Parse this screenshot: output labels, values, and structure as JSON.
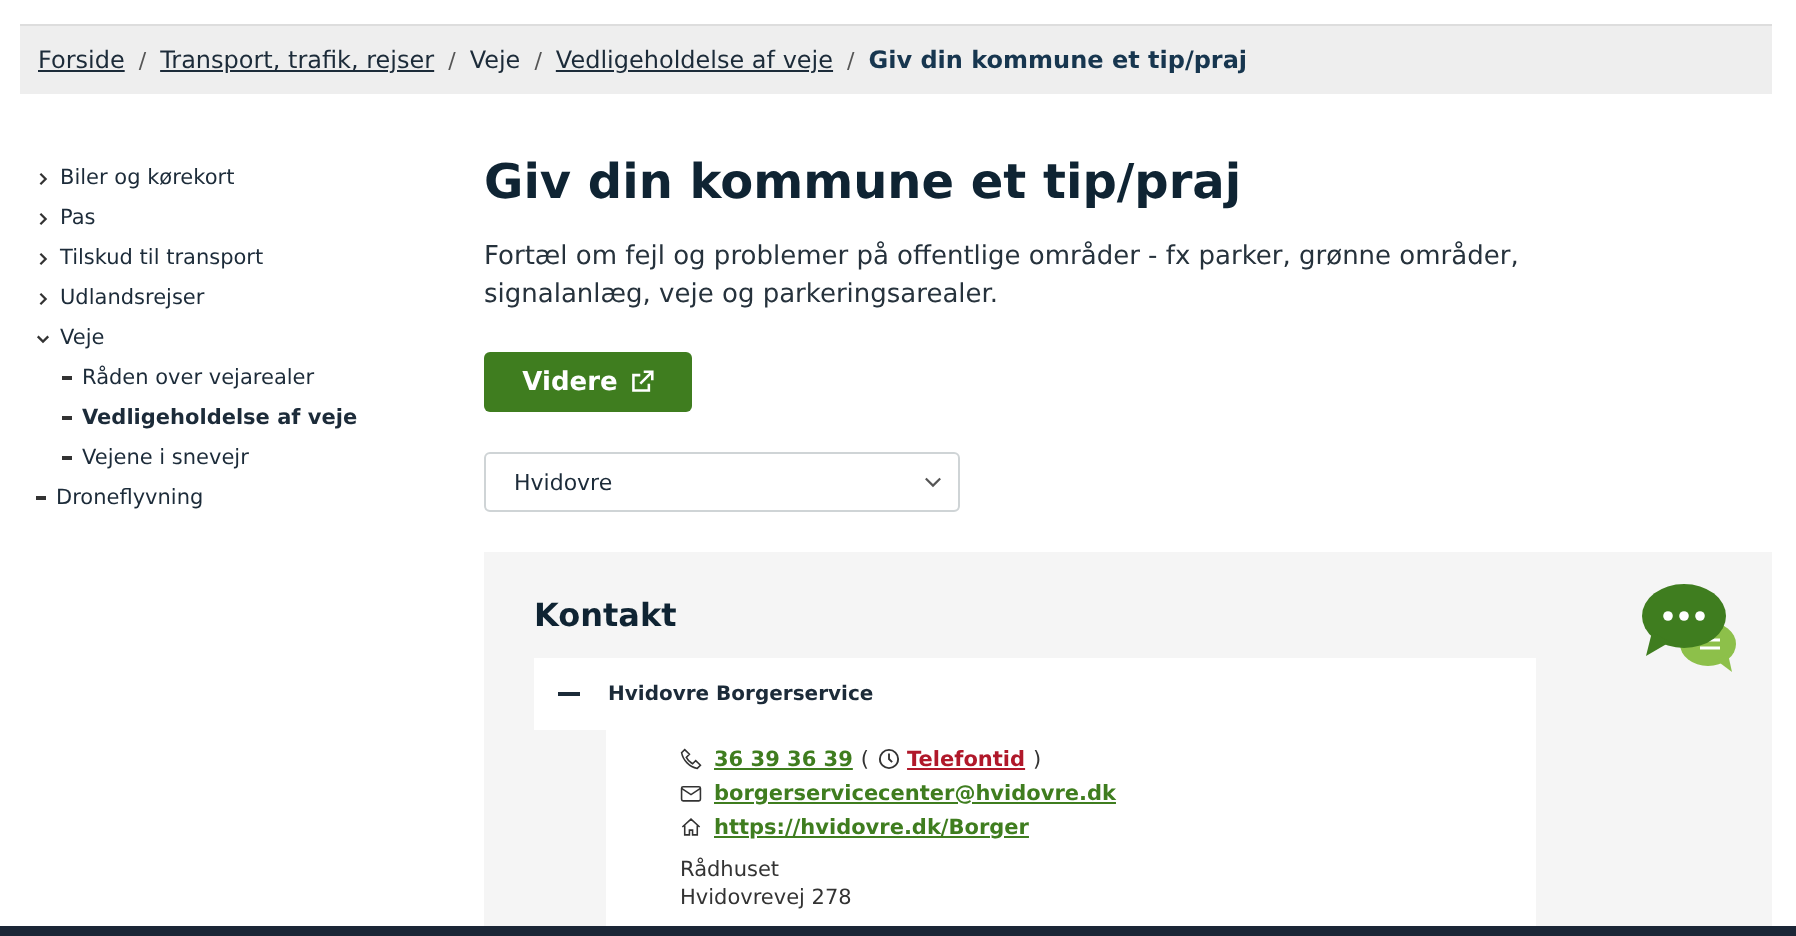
{
  "breadcrumb": {
    "separator": "/",
    "items": [
      {
        "label": "Forside",
        "link": true
      },
      {
        "label": "Transport, trafik, rejser",
        "link": true
      },
      {
        "label": "Veje",
        "link": false
      },
      {
        "label": "Vedligeholdelse af veje",
        "link": true
      },
      {
        "label": "Giv din kommune et tip/praj",
        "link": false
      }
    ]
  },
  "sidebar": {
    "items": [
      {
        "label": "Biler og kørekort",
        "kind": "section",
        "expanded": false
      },
      {
        "label": "Pas",
        "kind": "section",
        "expanded": false
      },
      {
        "label": "Tilskud til transport",
        "kind": "section",
        "expanded": false
      },
      {
        "label": "Udlandsrejser",
        "kind": "section",
        "expanded": false
      },
      {
        "label": "Veje",
        "kind": "section",
        "expanded": true,
        "children": [
          {
            "label": "Råden over vejarealer",
            "selected": false
          },
          {
            "label": "Vedligeholdelse af veje",
            "selected": true
          },
          {
            "label": "Vejene i snevejr",
            "selected": false
          }
        ]
      },
      {
        "label": "Droneflyvning",
        "kind": "leaf"
      }
    ]
  },
  "title": "Giv din kommune et tip/praj",
  "description": "Fortæl om fejl og problemer på offentlige områder - fx parker, grønne områder, signalanlæg, veje og parkeringsarealer.",
  "button": "Videre",
  "select": {
    "value": "Hvidovre"
  },
  "contact": {
    "heading": "Kontakt",
    "accordion": {
      "title": "Hvidovre Borgerservice",
      "expanded": true,
      "phone": "36 39 36 39",
      "hours_open": "(",
      "hours": "Telefontid",
      "hours_close": ")",
      "email": "borgerservicecenter@hvidovre.dk",
      "web": "https://hvidovre.dk/Borger",
      "address": [
        "Rådhuset",
        "Hvidovrevej 278"
      ]
    }
  }
}
